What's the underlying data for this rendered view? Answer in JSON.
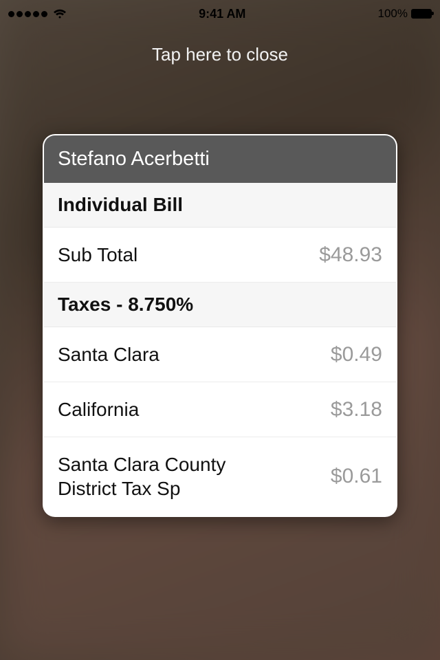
{
  "statusBar": {
    "time": "9:41 AM",
    "batteryPct": "100%"
  },
  "closeText": "Tap here to close",
  "card": {
    "personName": "Stefano Acerbetti",
    "sectionTitle1": "Individual Bill",
    "subtotal": {
      "label": "Sub Total",
      "value": "$48.93"
    },
    "sectionTitle2": "Taxes - 8.750%",
    "taxLines": [
      {
        "label": "Santa Clara",
        "value": "$0.49"
      },
      {
        "label": "California",
        "value": "$3.18"
      },
      {
        "label": "Santa Clara County District Tax Sp",
        "value": "$0.61"
      }
    ]
  }
}
